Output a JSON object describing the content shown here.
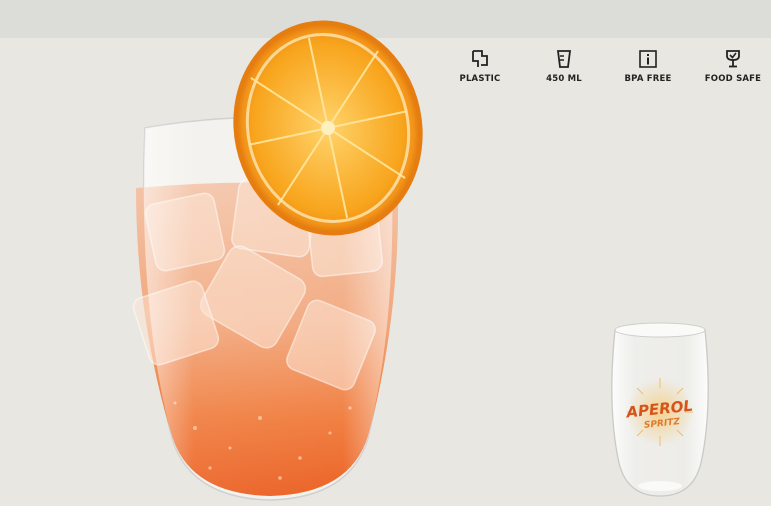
{
  "features": [
    {
      "icon": "material-icon",
      "label": "PLASTIC"
    },
    {
      "icon": "capacity-icon",
      "label": "450 ML"
    },
    {
      "icon": "info-icon",
      "label": "BPA FREE"
    },
    {
      "icon": "food-safe-glass-icon",
      "label": "FOOD SAFE"
    }
  ],
  "product": {
    "brand": "APEROL",
    "sub_brand": "SPRITZ"
  },
  "colors": {
    "background": "#e8e7e1",
    "top_bar": "#dcdcd9",
    "drink": "#f07a3a",
    "orange_slice": "#f59a1a",
    "brand_text": "#d5541c"
  }
}
